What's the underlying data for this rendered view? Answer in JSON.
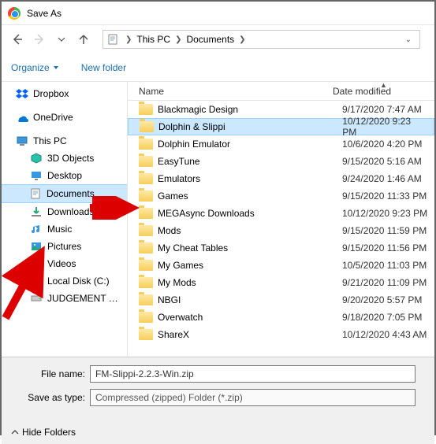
{
  "titlebar": {
    "title": "Save As"
  },
  "breadcrumb": {
    "root": "This PC",
    "folder": "Documents"
  },
  "toolbar": {
    "organize": "Organize",
    "new_folder": "New folder"
  },
  "sidebar": {
    "items": [
      {
        "label": "Dropbox",
        "icon": "dropbox",
        "indent": 0
      },
      {
        "label": "OneDrive",
        "icon": "onedrive",
        "indent": 0
      },
      {
        "label": "This PC",
        "icon": "thispc",
        "indent": 0
      },
      {
        "label": "3D Objects",
        "icon": "3d",
        "indent": 1
      },
      {
        "label": "Desktop",
        "icon": "desktop",
        "indent": 1
      },
      {
        "label": "Documents",
        "icon": "documents",
        "indent": 1,
        "selected": true
      },
      {
        "label": "Downloads",
        "icon": "downloads",
        "indent": 1
      },
      {
        "label": "Music",
        "icon": "music",
        "indent": 1
      },
      {
        "label": "Pictures",
        "icon": "pictures",
        "indent": 1
      },
      {
        "label": "Videos",
        "icon": "videos",
        "indent": 1
      },
      {
        "label": "Local Disk (C:)",
        "icon": "disk",
        "indent": 1
      },
      {
        "label": "JUDGEMENT NUT",
        "icon": "disk",
        "indent": 1
      }
    ]
  },
  "list_header": {
    "name_col": "Name",
    "date_col": "Date modified"
  },
  "files": [
    {
      "name": "Blackmagic Design",
      "date": "9/17/2020 7:47 AM"
    },
    {
      "name": "Dolphin & Slippi",
      "date": "10/12/2020 9:23 PM",
      "selected": true
    },
    {
      "name": "Dolphin Emulator",
      "date": "10/6/2020 4:20 PM"
    },
    {
      "name": "EasyTune",
      "date": "9/15/2020 5:16 AM"
    },
    {
      "name": "Emulators",
      "date": "9/24/2020 1:46 AM"
    },
    {
      "name": "Games",
      "date": "9/15/2020 11:33 PM"
    },
    {
      "name": "MEGAsync Downloads",
      "date": "10/12/2020 9:23 PM"
    },
    {
      "name": "Mods",
      "date": "9/15/2020 11:59 PM"
    },
    {
      "name": "My Cheat Tables",
      "date": "9/15/2020 11:56 PM"
    },
    {
      "name": "My Games",
      "date": "10/5/2020 11:03 PM"
    },
    {
      "name": "My Mods",
      "date": "9/21/2020 11:09 PM"
    },
    {
      "name": "NBGI",
      "date": "9/20/2020 5:57 PM"
    },
    {
      "name": "Overwatch",
      "date": "9/18/2020 7:05 PM"
    },
    {
      "name": "ShareX",
      "date": "10/12/2020 4:43 AM"
    }
  ],
  "form": {
    "file_name_label": "File name:",
    "file_name_value": "FM-Slippi-2.2.3-Win.zip",
    "save_type_label": "Save as type:",
    "save_type_value": "Compressed (zipped) Folder (*.zip)"
  },
  "footer": {
    "hide_folders": "Hide Folders"
  }
}
